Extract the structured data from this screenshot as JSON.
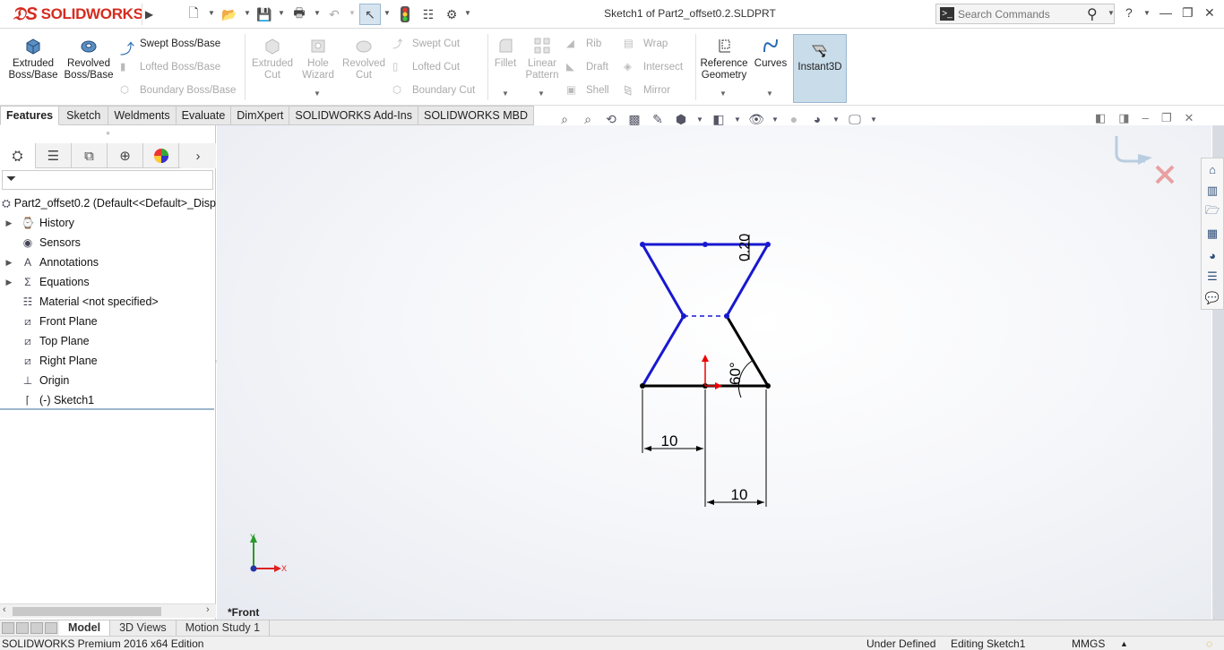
{
  "app": {
    "brand": "SOLIDWORKS",
    "title": "Sketch1 of Part2_offset0.2.SLDPRT"
  },
  "search": {
    "placeholder": "Search Commands"
  },
  "ribbon": {
    "extruded_boss": "Extruded Boss/Base",
    "revolved_boss": "Revolved Boss/Base",
    "swept_boss": "Swept Boss/Base",
    "lofted_boss": "Lofted Boss/Base",
    "boundary_boss": "Boundary Boss/Base",
    "extruded_cut": "Extruded Cut",
    "hole_wizard": "Hole Wizard",
    "revolved_cut": "Revolved Cut",
    "swept_cut": "Swept Cut",
    "lofted_cut": "Lofted Cut",
    "boundary_cut": "Boundary Cut",
    "fillet": "Fillet",
    "linear_pattern": "Linear Pattern",
    "rib": "Rib",
    "draft": "Draft",
    "shell": "Shell",
    "wrap": "Wrap",
    "intersect": "Intersect",
    "mirror": "Mirror",
    "reference_geometry": "Reference Geometry",
    "curves": "Curves",
    "instant3d": "Instant3D"
  },
  "tabs": [
    "Features",
    "Sketch",
    "Weldments",
    "Evaluate",
    "DimXpert",
    "SOLIDWORKS Add-Ins",
    "SOLIDWORKS MBD"
  ],
  "tree": {
    "root": "Part2_offset0.2  (Default<<Default>_Disp",
    "items": [
      "History",
      "Sensors",
      "Annotations",
      "Equations",
      "Material <not specified>",
      "Front Plane",
      "Top Plane",
      "Right Plane",
      "Origin",
      "(-) Sketch1"
    ]
  },
  "sketch": {
    "dim_left": "10",
    "dim_bottom": "10",
    "dim_angle": "60°",
    "dim_offset": "0.20",
    "axis_x": "X",
    "axis_y": "Y"
  },
  "viewport": {
    "view_name": "*Front"
  },
  "bottom_tabs": [
    "Model",
    "3D Views",
    "Motion Study 1"
  ],
  "status": {
    "edition": "SOLIDWORKS Premium 2016 x64 Edition",
    "definition": "Under Defined",
    "editing": "Editing Sketch1",
    "units": "MMGS"
  },
  "colors": {
    "brand": "#d52b1e",
    "sketch_line": "#1818d0",
    "instant3d_bg": "#c9dcea"
  }
}
